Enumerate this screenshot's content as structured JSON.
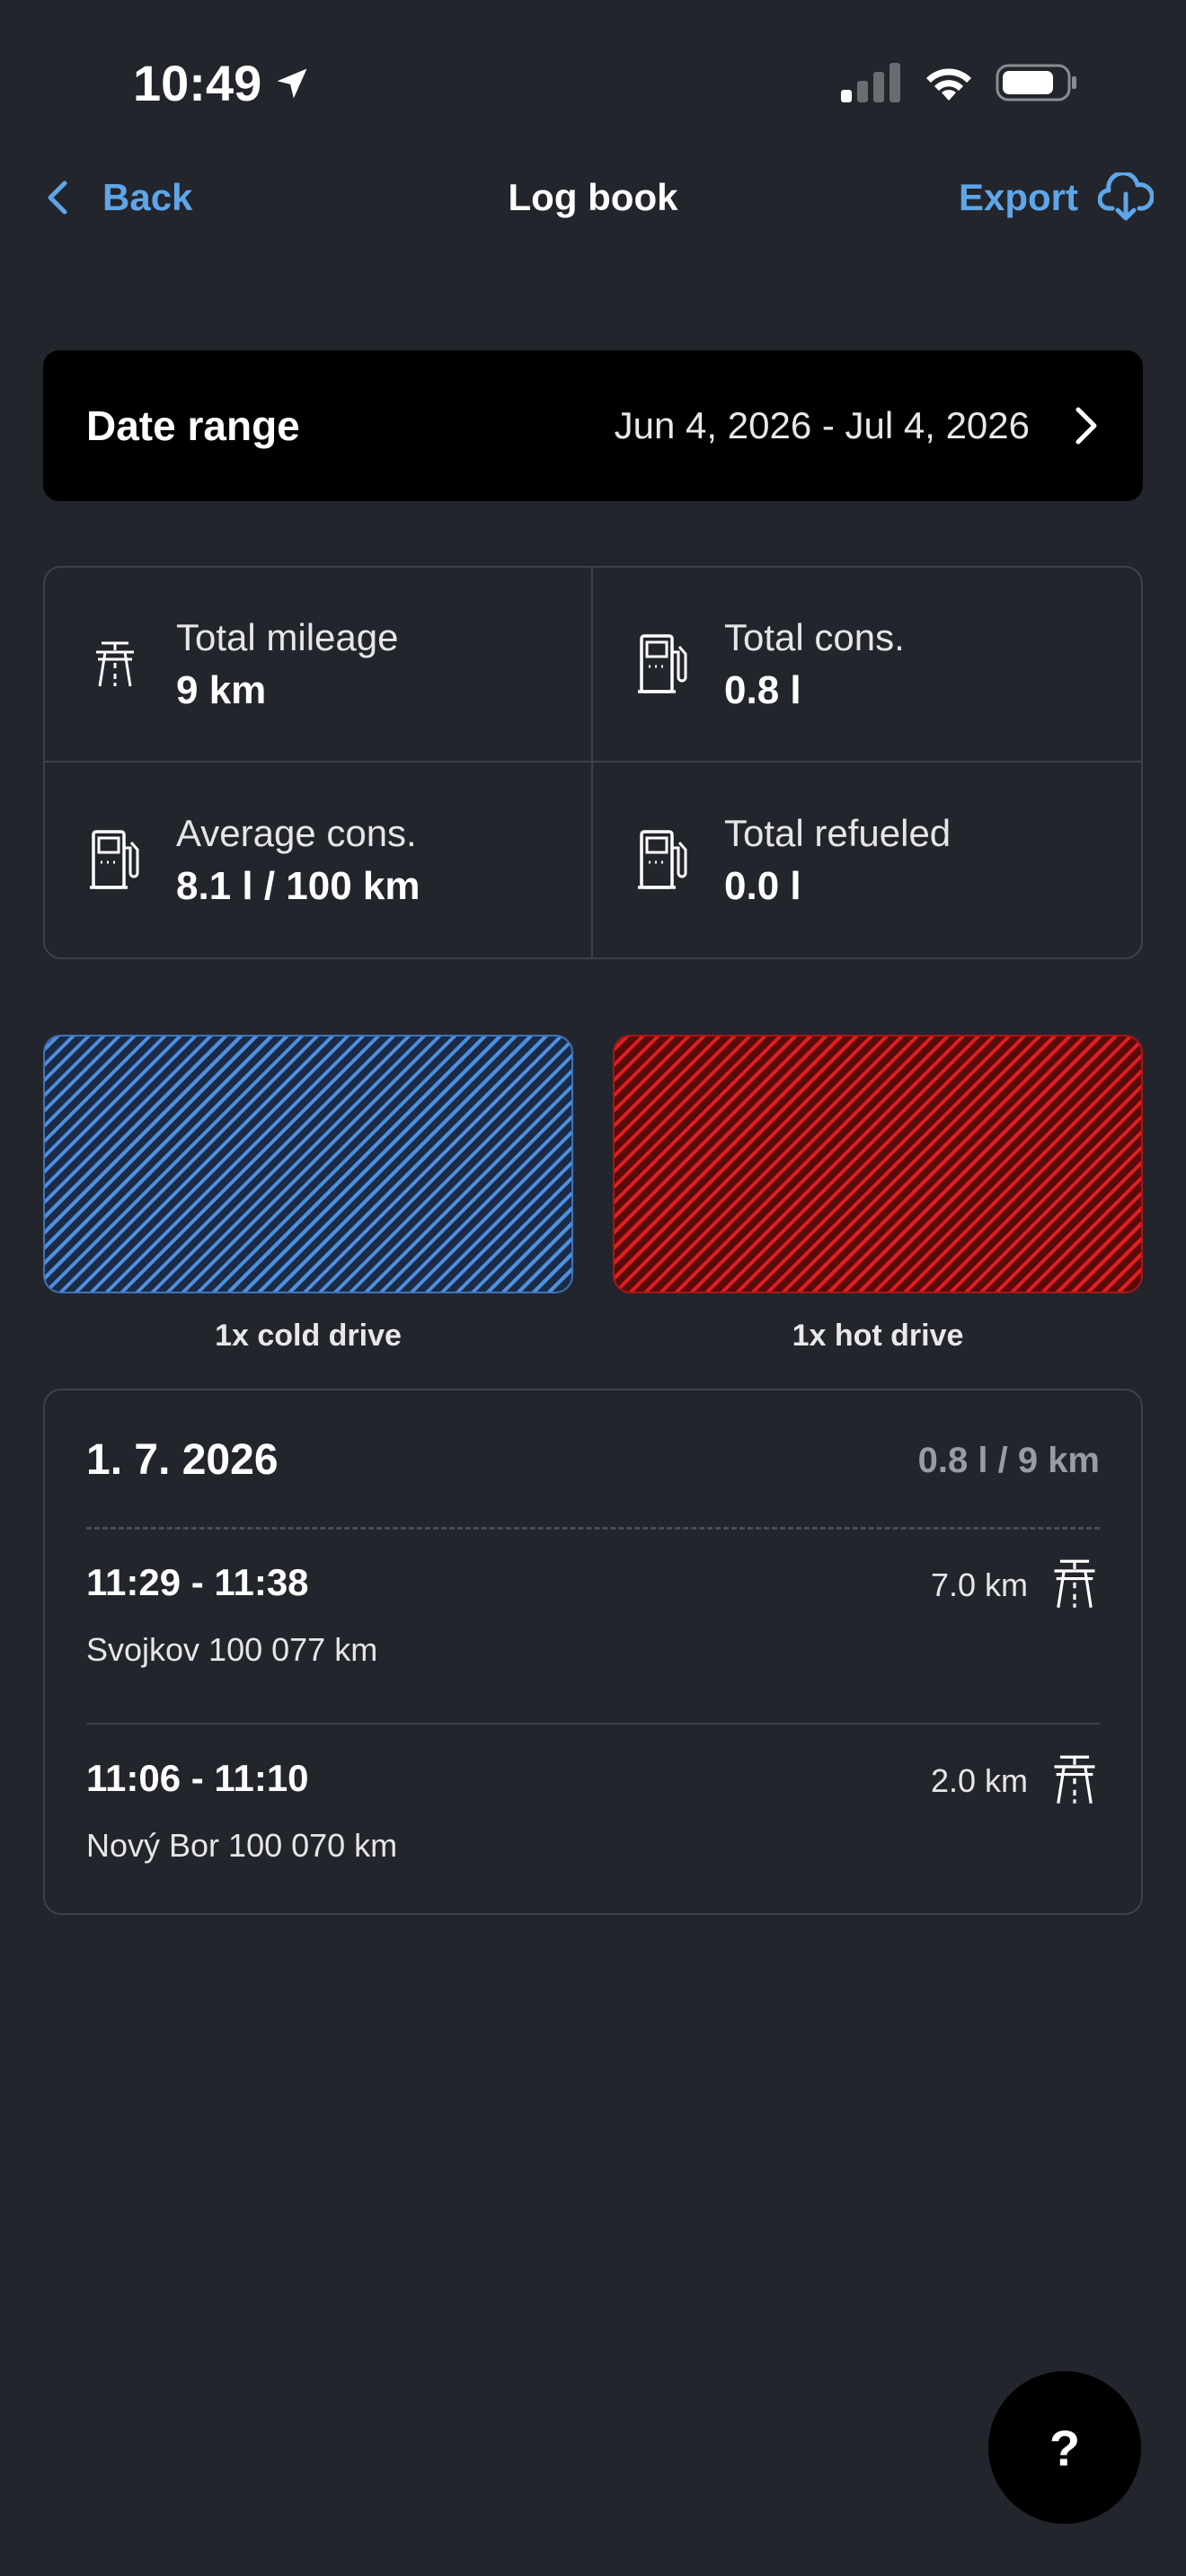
{
  "status_bar": {
    "time": "10:49"
  },
  "nav": {
    "back_label": "Back",
    "title": "Log book",
    "export_label": "Export"
  },
  "date_range": {
    "label": "Date range",
    "value": "Jun 4, 2026 - Jul 4, 2026"
  },
  "stats": [
    {
      "label": "Total mileage",
      "value": "9 km",
      "icon": "road-icon"
    },
    {
      "label": "Total cons.",
      "value": "0.8 l",
      "icon": "fuel-pump-icon"
    },
    {
      "label": "Average cons.",
      "value": "8.1 l / 100 km",
      "icon": "fuel-pump-icon"
    },
    {
      "label": "Total refueled",
      "value": "0.0 l",
      "icon": "fuel-pump-icon"
    }
  ],
  "drives": {
    "cold": {
      "label": "1x  cold drive",
      "color": "#4d8fe0"
    },
    "hot": {
      "label": "1x  hot drive",
      "color": "#e01f1f"
    }
  },
  "trips": {
    "date": "1. 7. 2026",
    "summary": "0.8 l / 9 km",
    "items": [
      {
        "time": "11:29 - 11:38",
        "place": "Svojkov 100 077 km",
        "distance": "7.0 km",
        "icon": "road-icon"
      },
      {
        "time": "11:06 - 11:10",
        "place": "Nový Bor 100 070 km",
        "distance": "2.0 km",
        "icon": "road-icon"
      }
    ]
  },
  "help": {
    "label": "?"
  },
  "colors": {
    "background": "#23252c",
    "accent": "#5ea6e8"
  }
}
